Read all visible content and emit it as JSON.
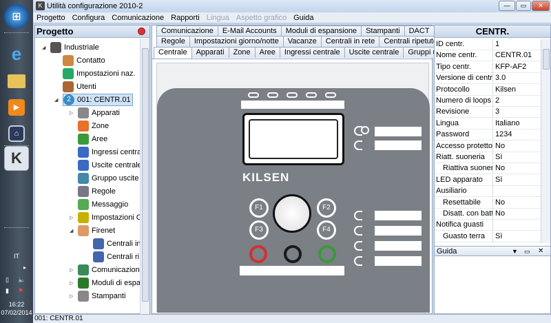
{
  "taskbar": {
    "language": "IT",
    "clock_time": "16:22",
    "clock_date": "07/02/2014"
  },
  "window": {
    "title": "Utilità configurazione 2010-2",
    "buttons": {
      "minimize": "—",
      "restore": "▭",
      "close": "✕"
    }
  },
  "menu": [
    {
      "label": "Progetto",
      "enabled": true
    },
    {
      "label": "Configura",
      "enabled": true
    },
    {
      "label": "Comunicazione",
      "enabled": true
    },
    {
      "label": "Rapporti",
      "enabled": true
    },
    {
      "label": "Lingua",
      "enabled": false
    },
    {
      "label": "Aspetto grafico",
      "enabled": false
    },
    {
      "label": "Guida",
      "enabled": true
    }
  ],
  "left_panel": {
    "title": "Progetto",
    "tree": [
      {
        "label": "Industriale",
        "icon": "project-icon",
        "color": "#555"
      },
      {
        "label": "Contatto",
        "icon": "contact-icon",
        "color": "#c84"
      },
      {
        "label": "Impostazioni naz.",
        "icon": "globe-icon",
        "color": "#2a6"
      },
      {
        "label": "Utenti",
        "icon": "users-icon",
        "color": "#a63"
      },
      {
        "label": "001: CENTR.01",
        "icon": "panel-number-icon",
        "color": "#3a8cc4"
      },
      {
        "label": "Apparati",
        "icon": "camera-icon",
        "color": "#888"
      },
      {
        "label": "Zone",
        "icon": "zones-icon",
        "color": "#e8702a"
      },
      {
        "label": "Aree",
        "icon": "areas-icon",
        "color": "#3a9a3a"
      },
      {
        "label": "Ingressi centrale",
        "icon": "inputs-icon",
        "color": "#3a6ac4"
      },
      {
        "label": "Uscite centrale",
        "icon": "outputs-icon",
        "color": "#3a6ac4"
      },
      {
        "label": "Gruppo uscite",
        "icon": "output-group-icon",
        "color": "#48a"
      },
      {
        "label": "Regole",
        "icon": "rules-gear-icon",
        "color": "#778"
      },
      {
        "label": "Messaggio",
        "icon": "message-icon",
        "color": "#5a5"
      },
      {
        "label": "Impostazioni C",
        "icon": "settings-icon",
        "color": "#c8b000"
      },
      {
        "label": "Firenet",
        "icon": "firenet-icon",
        "color": "#d96"
      },
      {
        "label": "Centrali in",
        "icon": "network-panels-icon",
        "color": "#46a"
      },
      {
        "label": "Centrali ri",
        "icon": "network-panels-icon",
        "color": "#46a"
      },
      {
        "label": "Comunicazion",
        "icon": "communication-icon",
        "color": "#3a8a5a"
      },
      {
        "label": "Moduli di espa",
        "icon": "modules-icon",
        "color": "#2a7a2a"
      },
      {
        "label": "Stampanti",
        "icon": "printer-icon",
        "color": "#888"
      }
    ]
  },
  "tabs": {
    "row1": [
      "Comunicazione",
      "E-Mail Accounts",
      "Moduli di espansione",
      "Stampanti",
      "DACT"
    ],
    "row2": [
      "Regole",
      "Impostazioni giorno/notte",
      "Vacanze",
      "Centrali in rete",
      "Centrali ripetute"
    ],
    "row3": [
      "Centrale",
      "Apparati",
      "Zone",
      "Aree",
      "Ingressi centrale",
      "Uscite centrale",
      "Gruppi uscita"
    ],
    "selected": "Centrale"
  },
  "device": {
    "brand": "KILSEN",
    "keys": [
      "F1",
      "F2",
      "F3",
      "F4"
    ],
    "colors": {
      "body": "#7b7f86",
      "red": "#d33030",
      "black": "#1a1a1a",
      "green": "#3a9a3a"
    }
  },
  "right_panel": {
    "title": "CENTR.",
    "properties": [
      {
        "key": "ID centr.",
        "value": "1"
      },
      {
        "key": "Nome centr.",
        "value": "CENTR.01"
      },
      {
        "key": "Tipo centr.",
        "value": "KFP-AF2"
      },
      {
        "key": "Versione di centra",
        "value": "3.0"
      },
      {
        "key": "Protocollo",
        "value": "Kilsen"
      },
      {
        "key": "Numero di loops",
        "value": "2"
      },
      {
        "key": "Revisione",
        "value": "3"
      },
      {
        "key": "Lingua",
        "value": "Italiano"
      },
      {
        "key": "Password",
        "value": "1234"
      },
      {
        "key": "Accesso protetto",
        "value": "No"
      },
      {
        "key": "Riatt. suoneria",
        "value": "Sì"
      },
      {
        "key": "Riattiva suoneri",
        "value": "No",
        "indent": true
      },
      {
        "key": "LED apparato",
        "value": "Sì"
      },
      {
        "key": "Ausiliario",
        "value": ""
      },
      {
        "key": "Resettabile",
        "value": "No",
        "indent": true
      },
      {
        "key": "Disatt. con batt",
        "value": "No",
        "indent": true
      },
      {
        "key": "Notifica guasti",
        "value": ""
      },
      {
        "key": "Guasto terra",
        "value": "Sì",
        "indent": true
      }
    ],
    "guide_title": "Guida",
    "guide_buttons": {
      "menu": "▼",
      "pin": "▭",
      "close": "✕"
    }
  },
  "status": {
    "text": "001: CENTR.01"
  }
}
